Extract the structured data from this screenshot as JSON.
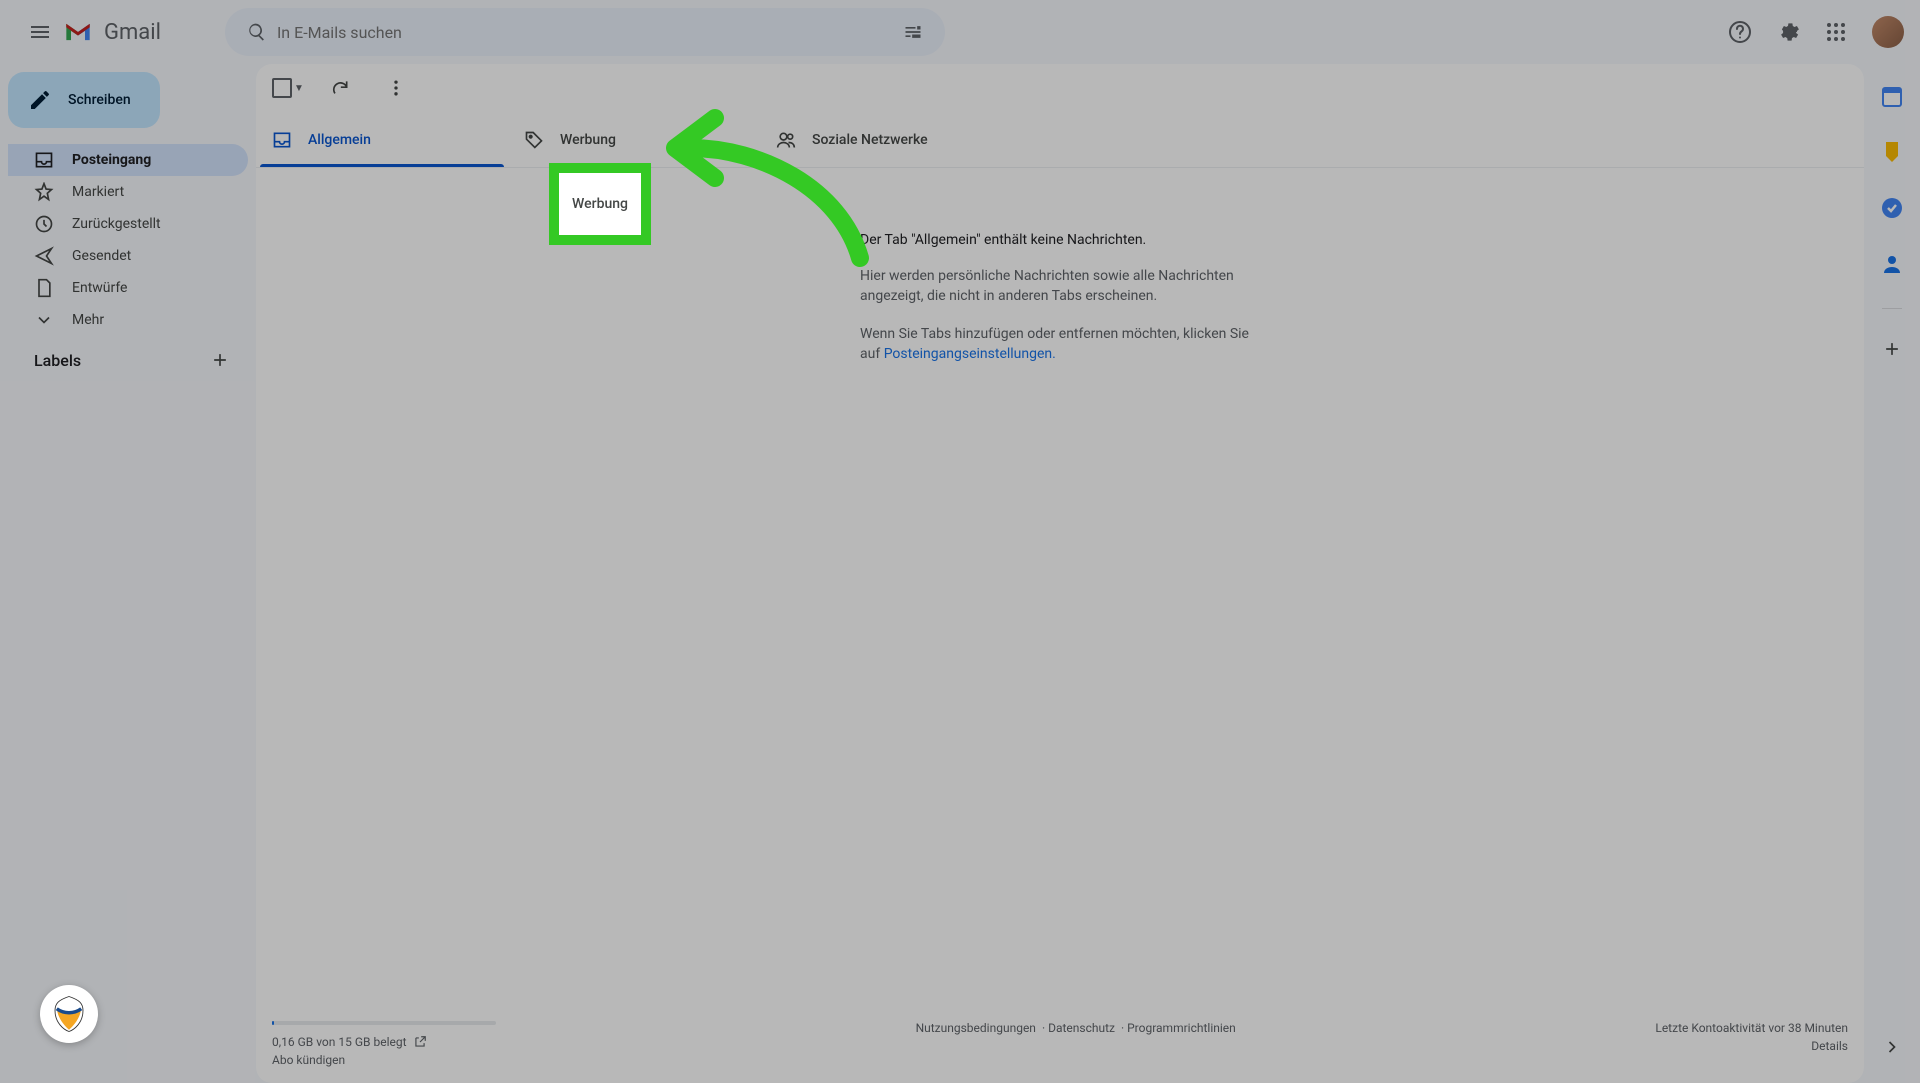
{
  "header": {
    "brand_text": "Gmail",
    "search_placeholder": "In E-Mails suchen"
  },
  "sidebar": {
    "compose_label": "Schreiben",
    "items": [
      {
        "label": "Posteingang"
      },
      {
        "label": "Markiert"
      },
      {
        "label": "Zurückgestellt"
      },
      {
        "label": "Gesendet"
      },
      {
        "label": "Entwürfe"
      },
      {
        "label": "Mehr"
      }
    ],
    "labels_heading": "Labels"
  },
  "tabs": [
    {
      "label": "Allgemein"
    },
    {
      "label": "Werbung"
    },
    {
      "label": "Soziale Netzwerke"
    }
  ],
  "empty": {
    "title": "Der Tab \"Allgemein\" enthält keine Nachrichten.",
    "body": "Hier werden persönliche Nachrichten sowie alle Nachrichten angezeigt, die nicht in anderen Tabs erscheinen.",
    "hint_prefix": "Wenn Sie Tabs hinzufügen oder entfernen möchten, klicken Sie auf ",
    "hint_link": "Posteingangseinstellungen."
  },
  "footer": {
    "storage_text": "0,16 GB von 15 GB belegt",
    "cancel_sub": "Abo kündigen",
    "terms": "Nutzungsbedingungen",
    "privacy": "Datenschutz",
    "policies": "Programmrichtlinien",
    "activity": "Letzte Kontoaktivität vor 38 Minuten",
    "details": "Details"
  },
  "highlight": {
    "text": "Werbung"
  }
}
